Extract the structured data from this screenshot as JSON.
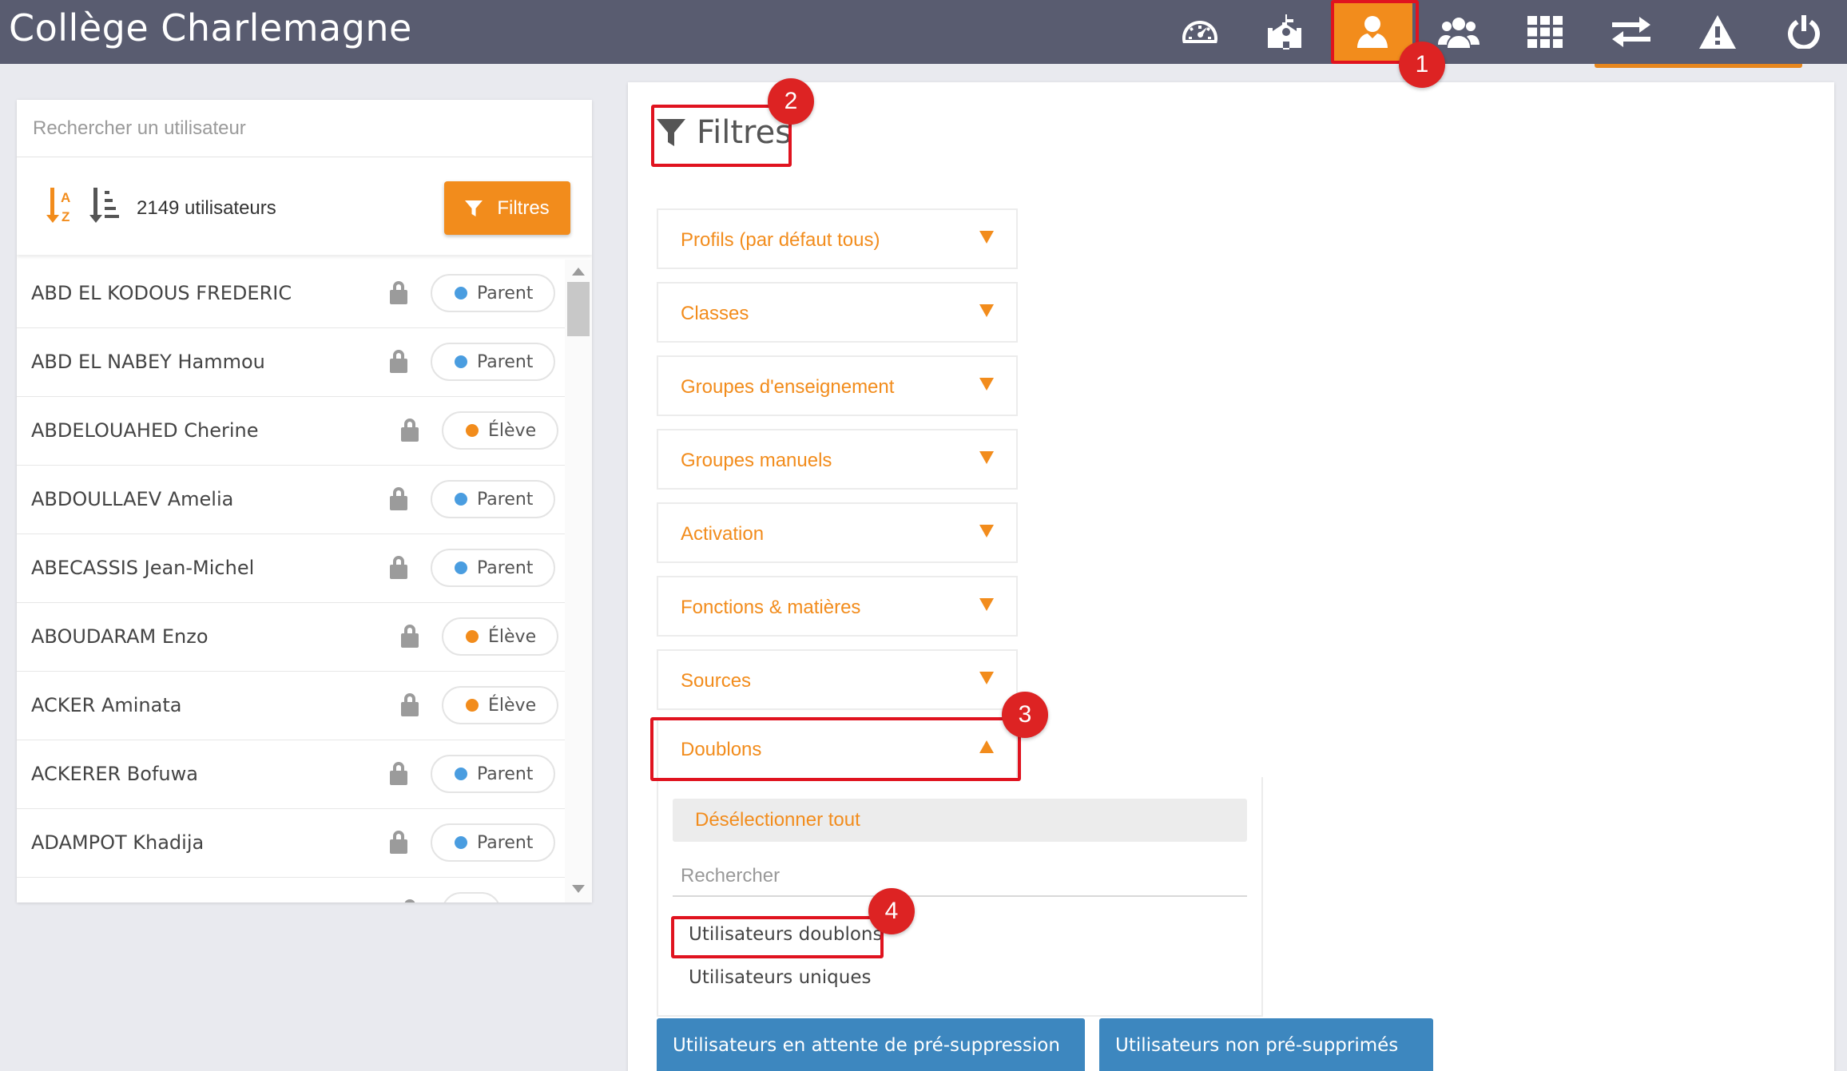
{
  "app": {
    "title": "Collège Charlemagne"
  },
  "nav": {
    "icons": [
      "dashboard-icon",
      "school-icon",
      "user-icon",
      "group-icon",
      "apps-grid-icon",
      "transfer-icon",
      "warning-icon",
      "power-icon"
    ],
    "active": "user-icon"
  },
  "annotations": [
    "1",
    "2",
    "3",
    "4"
  ],
  "left_panel": {
    "search_placeholder": "Rechercher un utilisateur",
    "user_count": "2149 utilisateurs",
    "filters_button": "Filtres",
    "users": [
      {
        "name": "ABD EL KODOUS FREDERIC",
        "role": "Parent"
      },
      {
        "name": "ABD EL NABEY Hammou",
        "role": "Parent"
      },
      {
        "name": "ABDELOUAHED Cherine",
        "role": "Élève"
      },
      {
        "name": "ABDOULLAEV Amelia",
        "role": "Parent"
      },
      {
        "name": "ABECASSIS Jean-Michel",
        "role": "Parent"
      },
      {
        "name": "ABOUDARAM Enzo",
        "role": "Élève"
      },
      {
        "name": "ACKER Aminata",
        "role": "Élève"
      },
      {
        "name": "ACKERER Bofuwa",
        "role": "Parent"
      },
      {
        "name": "ADAMPOT Khadija",
        "role": "Parent"
      }
    ]
  },
  "right_panel": {
    "title": "Filtres",
    "filters": [
      {
        "label": "Profils (par défaut tous)",
        "open": false
      },
      {
        "label": "Classes",
        "open": false
      },
      {
        "label": "Groupes d'enseignement",
        "open": false
      },
      {
        "label": "Groupes manuels",
        "open": false
      },
      {
        "label": "Activation",
        "open": false
      },
      {
        "label": "Fonctions & matières",
        "open": false
      },
      {
        "label": "Sources",
        "open": false
      },
      {
        "label": "Doublons",
        "open": true
      }
    ],
    "dropdown": {
      "deselect_all": "Désélectionner tout",
      "search_placeholder": "Rechercher",
      "options": [
        "Utilisateurs doublons",
        "Utilisateurs uniques"
      ]
    },
    "bottom_buttons": [
      "Utilisateurs en attente de pré-suppression",
      "Utilisateurs non pré-supprimés"
    ]
  },
  "colors": {
    "topbar": "#595c70",
    "accent": "#f28c1c",
    "parent_dot": "#4a9de0",
    "eleve_dot": "#f28c1c",
    "annotation": "#dd2323",
    "bottom_button": "#3d87bf"
  }
}
